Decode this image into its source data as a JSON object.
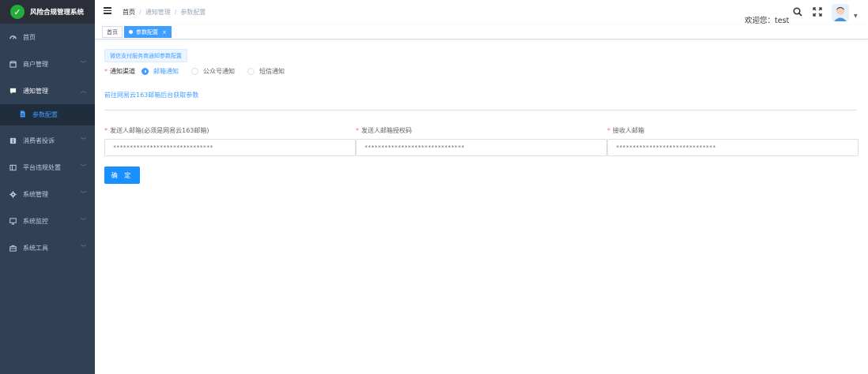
{
  "app": {
    "title": "风险合规管理系统"
  },
  "sidebar": {
    "items": [
      {
        "label": "首页",
        "icon": "dashboard-icon"
      },
      {
        "label": "商户管理",
        "icon": "shop-icon"
      },
      {
        "label": "通知管理",
        "icon": "message-icon"
      },
      {
        "label": "消费者投诉",
        "icon": "complaint-icon"
      },
      {
        "label": "平台违规处置",
        "icon": "violation-icon"
      },
      {
        "label": "系统管理",
        "icon": "gear-icon"
      },
      {
        "label": "系统监控",
        "icon": "monitor-icon"
      },
      {
        "label": "系统工具",
        "icon": "toolbox-icon"
      }
    ],
    "subitem": {
      "label": "参数配置",
      "icon": "document-icon"
    }
  },
  "navbar": {
    "breadcrumb": [
      "首页",
      "通知管理",
      "参数配置"
    ],
    "welcome": "欢迎您：test"
  },
  "tags": [
    {
      "label": "首页"
    },
    {
      "label": "参数配置",
      "close": "×"
    }
  ],
  "main": {
    "section_button": "微信支付服务商通知参数配置",
    "channel": {
      "label": "通知渠道",
      "required_mark": "*",
      "options": [
        "邮箱通知",
        "公众号通知",
        "短信通知"
      ],
      "selected": "邮箱通知"
    },
    "link_text": "前往网易云163邮箱后台获取参数",
    "fields": [
      {
        "label": "发送人邮箱(必须是网易云163邮箱)",
        "value": "******************************"
      },
      {
        "label": "发送人邮箱授权码",
        "value": "******************************"
      },
      {
        "label": "接收人邮箱",
        "value": "******************************"
      }
    ],
    "confirm_label": "确 定"
  },
  "colors": {
    "primary": "#409eff",
    "sidebar_bg": "#304156",
    "submenu_bg": "#1f2d3d",
    "required": "#f56c6c",
    "confirm_bg": "#1890ff"
  }
}
